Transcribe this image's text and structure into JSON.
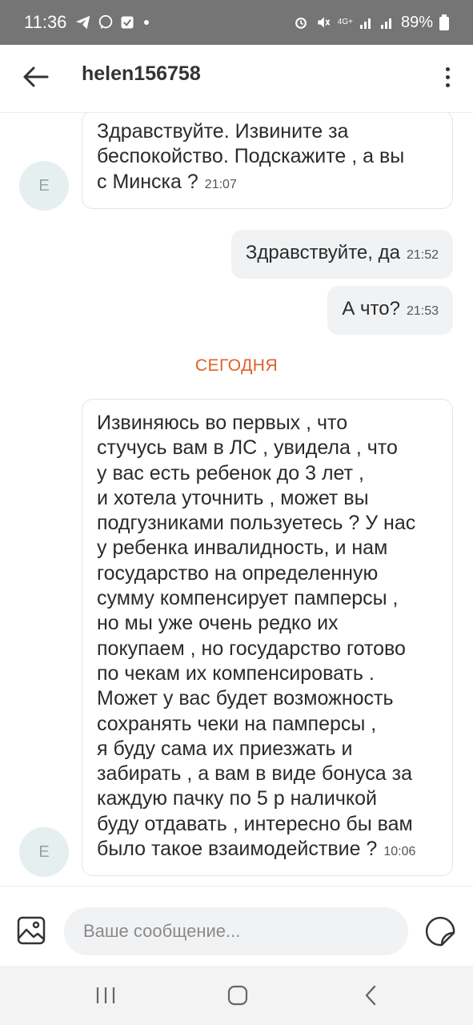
{
  "status_bar": {
    "time": "11:36",
    "battery": "89%",
    "network": "4G+"
  },
  "header": {
    "title": "helen156758"
  },
  "messages": [
    {
      "direction": "in",
      "avatar": "E",
      "text": "Здравствуйте. Извините за\nбеспокойство. Подскажите , а вы\nс  Минска ?",
      "time": "21:07"
    },
    {
      "direction": "out",
      "text": "Здравствуйте, да",
      "time": "21:52"
    },
    {
      "direction": "out",
      "text": "А что?",
      "time": "21:53"
    },
    {
      "direction": "separator",
      "text": "СЕГОДНЯ"
    },
    {
      "direction": "in",
      "avatar": "E",
      "text": "Извиняюсь во первых , что\nстучусь вам в ЛС , увидела , что\nу вас есть ребенок до 3 лет ,\nи хотела уточнить , может вы\nподгузниками пользуетесь ? У нас\nу ребенка инвалидность, и нам\nгосударство на определенную\nсумму компенсирует памперсы ,\nно мы уже  очень редко их\nпокупаем , но государство готово\nпо чекам их компенсировать .\nМожет у вас будет возможность\nсохранять чеки на памперсы ,\nя буду сама их приезжать и\nзабирать , а вам в виде бонуса за\nкаждую пачку по 5 р наличкой\nбуду отдавать , интересно бы вам\nбыло такое взаимодействие ?",
      "time": "10:06"
    }
  ],
  "composer": {
    "placeholder": "Ваше сообщение..."
  },
  "colors": {
    "status_bar_bg": "#757575",
    "accent_separator": "#e0602a",
    "avatar_bg": "#e6efef",
    "outgoing_bubble": "#f1f2f4"
  },
  "icons": {
    "back": "arrow-left-icon",
    "menu": "more-vertical-icon",
    "gallery": "image-icon",
    "sticker": "sticker-icon"
  }
}
